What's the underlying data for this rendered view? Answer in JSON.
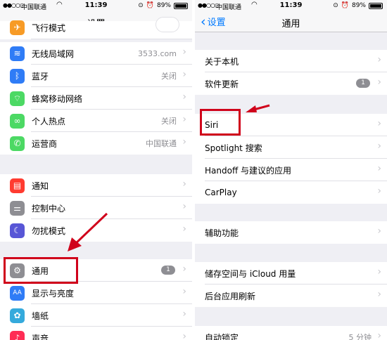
{
  "status": {
    "dots": "●●○○○",
    "carrier": "中国联通",
    "time": "11:39",
    "battery": "89%",
    "battery_level": 0.89
  },
  "left": {
    "nav_title": "设置",
    "rows": [
      {
        "label": "飞行模式",
        "value": "",
        "icon": "airplane-icon",
        "color": "#f79b26"
      },
      {
        "label": "无线局域网",
        "value": "3533.com",
        "icon": "wifi-icon",
        "color": "#2f7cf6"
      },
      {
        "label": "蓝牙",
        "value": "关闭",
        "icon": "bluetooth-icon",
        "color": "#2f7cf6"
      },
      {
        "label": "蜂窝移动网络",
        "value": "",
        "icon": "cellular-icon",
        "color": "#4cd964"
      },
      {
        "label": "个人热点",
        "value": "关闭",
        "icon": "hotspot-icon",
        "color": "#4cd964"
      },
      {
        "label": "运营商",
        "value": "中国联通",
        "icon": "phone-icon",
        "color": "#4cd964"
      },
      {
        "label": "通知",
        "value": "",
        "icon": "notifications-icon",
        "color": "#ff3b30"
      },
      {
        "label": "控制中心",
        "value": "",
        "icon": "control-center-icon",
        "color": "#8e8e93"
      },
      {
        "label": "勿扰模式",
        "value": "",
        "icon": "moon-icon",
        "color": "#5856d6"
      },
      {
        "label": "通用",
        "value": "",
        "badge": "1",
        "icon": "gear-icon",
        "color": "#8e8e93"
      },
      {
        "label": "显示与亮度",
        "value": "",
        "icon": "display-icon",
        "color": "#2f7cf6"
      },
      {
        "label": "墙纸",
        "value": "",
        "icon": "wallpaper-icon",
        "color": "#35aadc"
      },
      {
        "label": "声音",
        "value": "",
        "icon": "sound-icon",
        "color": "#ff2d55"
      }
    ]
  },
  "right": {
    "back_label": "设置",
    "nav_title": "通用",
    "rows": [
      {
        "label": "关于本机",
        "value": ""
      },
      {
        "label": "软件更新",
        "value": "",
        "badge": "1"
      },
      {
        "label": "Siri",
        "value": ""
      },
      {
        "label": "Spotlight 搜索",
        "value": ""
      },
      {
        "label": "Handoff 与建议的应用",
        "value": ""
      },
      {
        "label": "CarPlay",
        "value": ""
      },
      {
        "label": "辅助功能",
        "value": ""
      },
      {
        "label": "储存空间与 iCloud 用量",
        "value": ""
      },
      {
        "label": "后台应用刷新",
        "value": ""
      },
      {
        "label": "自动锁定",
        "value": "5 分钟"
      }
    ]
  },
  "annotation_color": "#d0021b"
}
